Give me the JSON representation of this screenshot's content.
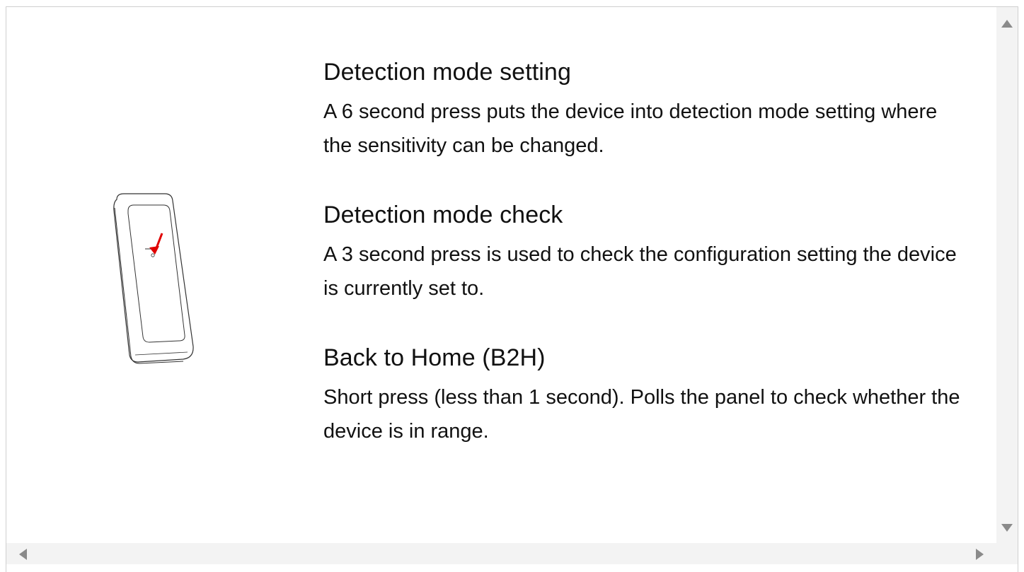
{
  "sections": [
    {
      "title": "Detection mode setting",
      "body": "A 6 second press puts the device into detection mode setting where the sensitivity can be changed."
    },
    {
      "title": "Detection mode check",
      "body": "A 3 second press is used to check the configuration setting the device is currently set to."
    },
    {
      "title": "Back to Home (B2H)",
      "body": "Short press (less than 1 second). Polls the panel to check whether the device is in range."
    }
  ],
  "illustration": {
    "icon": "door-sensor-device-icon",
    "indicator_icon": "press-arrow-icon",
    "indicator_color": "#e00000",
    "outline_color": "#333333"
  },
  "scrollbars": {
    "track_color": "#f3f3f3",
    "arrow_color": "#8a8a8a"
  }
}
